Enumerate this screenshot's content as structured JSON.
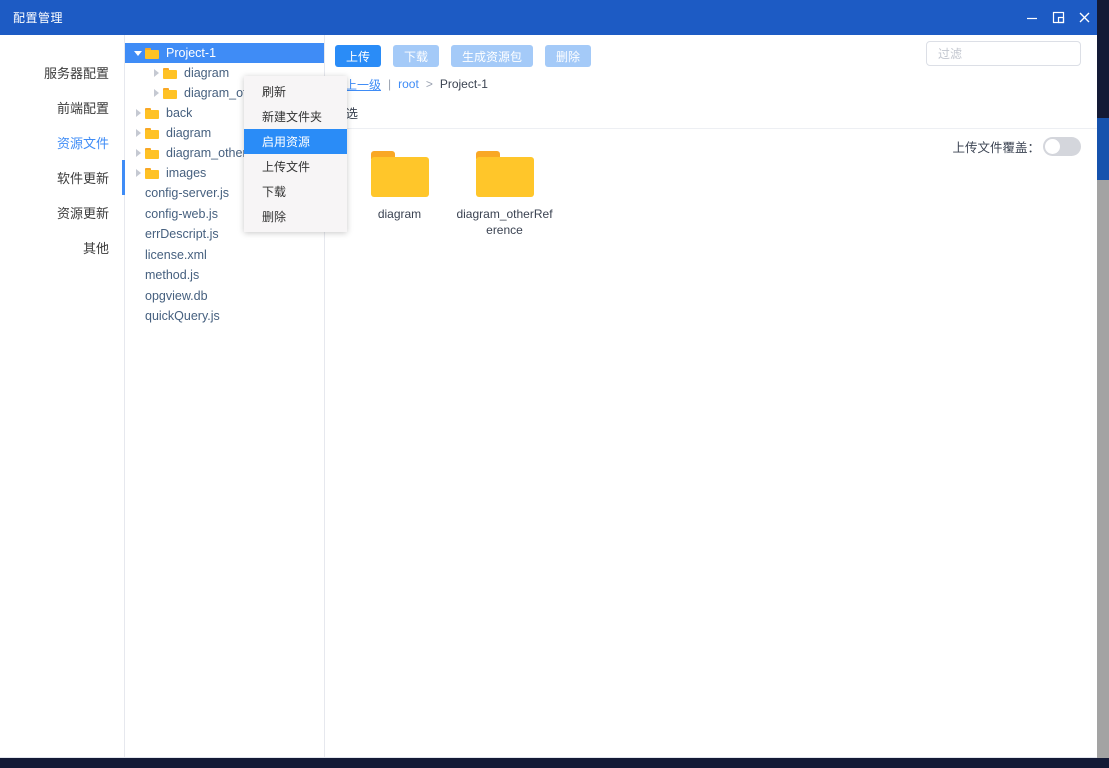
{
  "window": {
    "title": "配置管理",
    "controls": [
      {
        "name": "minimize",
        "glyph": "minimize-icon"
      },
      {
        "name": "maximize",
        "glyph": "maximize-icon"
      },
      {
        "name": "close",
        "glyph": "close-icon"
      }
    ]
  },
  "sidebar": {
    "items": [
      {
        "label": "服务器配置",
        "active": false
      },
      {
        "label": "前端配置",
        "active": false
      },
      {
        "label": "资源文件",
        "active": true
      },
      {
        "label": "软件更新",
        "active": false
      },
      {
        "label": "资源更新",
        "active": false
      },
      {
        "label": "其他",
        "active": false
      }
    ]
  },
  "tree": {
    "nodes": [
      {
        "label": "Project-1",
        "depth": 0,
        "expandable": true,
        "expanded": true,
        "selected": true,
        "type": "folder"
      },
      {
        "label": "diagram",
        "depth": 1,
        "expandable": true,
        "expanded": false,
        "selected": false,
        "type": "folder"
      },
      {
        "label": "diagram_oth",
        "depth": 1,
        "expandable": true,
        "expanded": false,
        "selected": false,
        "type": "folder"
      },
      {
        "label": "back",
        "depth": 0,
        "expandable": true,
        "expanded": false,
        "selected": false,
        "type": "folder"
      },
      {
        "label": "diagram",
        "depth": 0,
        "expandable": true,
        "expanded": false,
        "selected": false,
        "type": "folder"
      },
      {
        "label": "diagram_otherl",
        "depth": 0,
        "expandable": true,
        "expanded": false,
        "selected": false,
        "type": "folder"
      },
      {
        "label": "images",
        "depth": 0,
        "expandable": true,
        "expanded": false,
        "selected": false,
        "type": "folder"
      }
    ],
    "files": [
      {
        "label": "config-server.js"
      },
      {
        "label": "config-web.js"
      },
      {
        "label": "errDescript.js"
      },
      {
        "label": "license.xml"
      },
      {
        "label": "method.js"
      },
      {
        "label": "opgview.db"
      },
      {
        "label": "quickQuery.js"
      }
    ]
  },
  "toolbar": {
    "buttons": [
      {
        "label": "上传",
        "primary": true
      },
      {
        "label": "下载",
        "primary": false
      },
      {
        "label": "生成资源包",
        "primary": false
      },
      {
        "label": "删除",
        "primary": false
      }
    ]
  },
  "breadcrumb": {
    "up_label": "回上一级",
    "divider": "|",
    "root_label": "root",
    "separator": ">",
    "current_label": "Project-1"
  },
  "select_all_label": "全选",
  "filter": {
    "placeholder": "过滤",
    "value": ""
  },
  "overwrite": {
    "label": "上传文件覆盖：",
    "enabled": false
  },
  "files_grid": {
    "items": [
      {
        "label": "diagram"
      },
      {
        "label": "diagram_otherReference"
      }
    ]
  },
  "context_menu": {
    "items": [
      {
        "label": "刷新",
        "highlight": false
      },
      {
        "label": "新建文件夹",
        "highlight": false
      },
      {
        "label": "启用资源",
        "highlight": true
      },
      {
        "label": "上传文件",
        "highlight": false
      },
      {
        "label": "下载",
        "highlight": false
      },
      {
        "label": "删除",
        "highlight": false
      }
    ]
  },
  "colors": {
    "titlebar": "#1d5bc4",
    "accent": "#3f8cf6",
    "button_primary": "#2a8cf7",
    "button_muted": "#a4caf8",
    "folder": "#ffc62a"
  }
}
